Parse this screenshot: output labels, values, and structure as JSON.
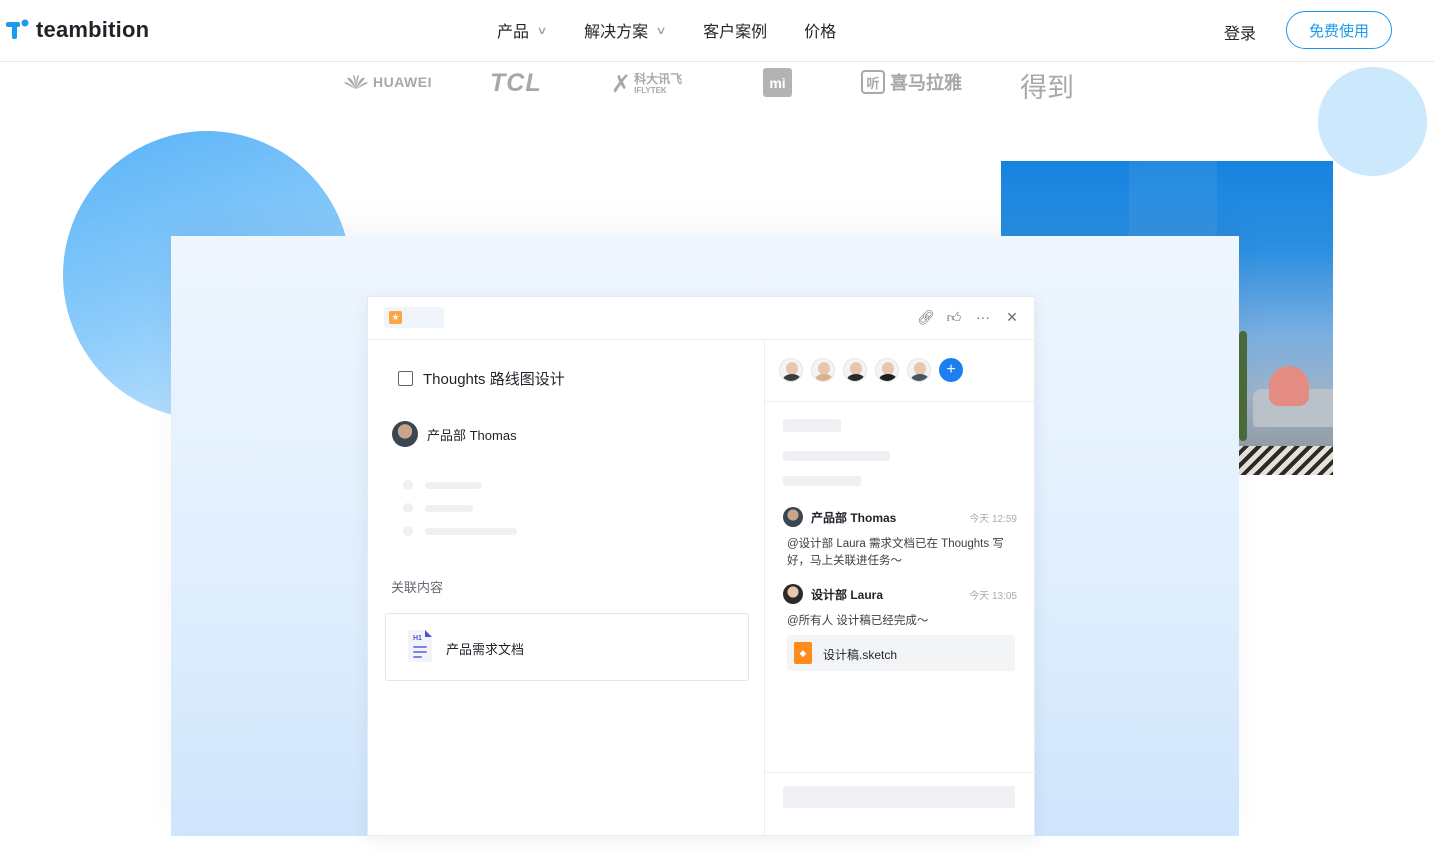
{
  "header": {
    "logo_text": "teambition",
    "nav": [
      {
        "label": "产品",
        "has_dropdown": true
      },
      {
        "label": "解决方案",
        "has_dropdown": true
      },
      {
        "label": "客户案例",
        "has_dropdown": false
      },
      {
        "label": "价格",
        "has_dropdown": false
      }
    ],
    "login_label": "登录",
    "cta_label": "免费使用"
  },
  "brands": {
    "huawei": "HUAWEI",
    "tcl": "TCL",
    "iflytek_cn": "科大讯飞",
    "iflytek_en": "IFLYTEK",
    "mi": "mi",
    "ximalaya_icon": "听",
    "ximalaya": "喜马拉雅",
    "dedao": "得到"
  },
  "task_card": {
    "task_title": "Thoughts 路线图设计",
    "assignee": "产品部 Thomas",
    "related_label": "关联内容",
    "related_doc": "产品需求文档",
    "doc_tag": "H1",
    "top_icons": [
      "link-icon",
      "thumbs-up-icon",
      "more-icon",
      "close-icon"
    ],
    "messages": [
      {
        "author": "产品部 Thomas",
        "time": "今天 12:59",
        "body": "@设计部 Laura 需求文档已在 Thoughts 写好，马上关联进任务～"
      },
      {
        "author": "设计部 Laura",
        "time": "今天 13:05",
        "body": "@所有人 设计稿已经完成～"
      }
    ],
    "attachment": "设计稿.sketch",
    "add_member_symbol": "+"
  },
  "colors": {
    "brand_blue": "#1b9aee",
    "accent_blue": "#1b7ff1",
    "sketch_orange": "#ff8a1e",
    "star_orange": "#ffa53d"
  }
}
